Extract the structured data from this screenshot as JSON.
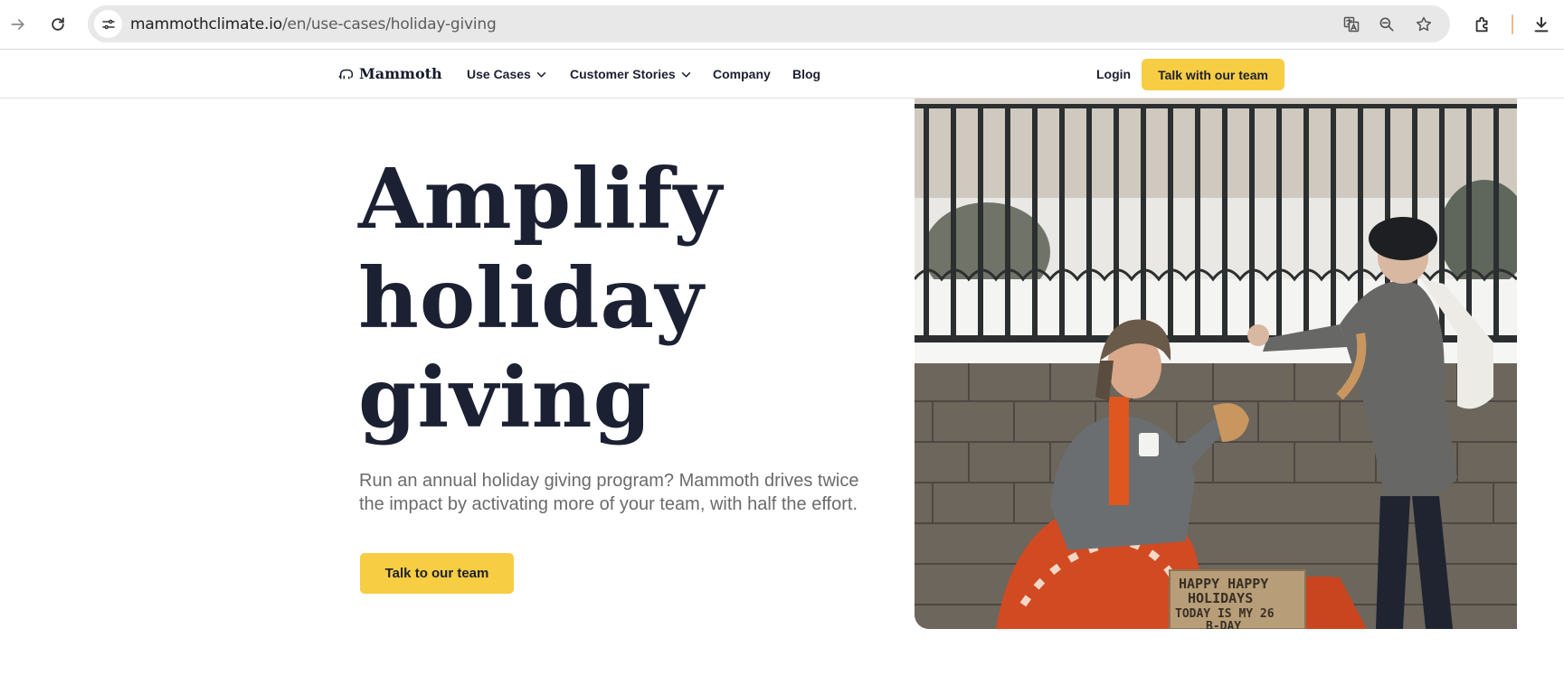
{
  "browser": {
    "url_host": "mammothclimate.io",
    "url_path": "/en/use-cases/holiday-giving",
    "icons": [
      "forward-icon",
      "reload-icon",
      "site-info-icon",
      "translate-icon",
      "zoom-icon",
      "bookmark-star-icon",
      "extensions-icon",
      "download-icon"
    ]
  },
  "header": {
    "logo": "Mammoth",
    "nav": {
      "use_cases": "Use Cases",
      "customer_stories": "Customer Stories",
      "company": "Company",
      "blog": "Blog"
    },
    "login": "Login",
    "cta": "Talk with our team"
  },
  "hero": {
    "title_line1": "Amplify",
    "title_line2": "holiday",
    "title_line3": "giving",
    "subtitle": "Run an annual holiday giving program? Mammoth drives twice the impact by activating more of your team, with half the effort.",
    "cta": "Talk to our team"
  },
  "photo": {
    "sign_line1": "HAPPY HAPPY",
    "sign_line2": "HOLIDAYS",
    "sign_line3": "TODAY IS MY 26",
    "sign_line4": "B-DAY"
  },
  "colors": {
    "accent": "#f7cd43",
    "heading": "#1c2033",
    "muted_text": "#6b6b6b"
  }
}
